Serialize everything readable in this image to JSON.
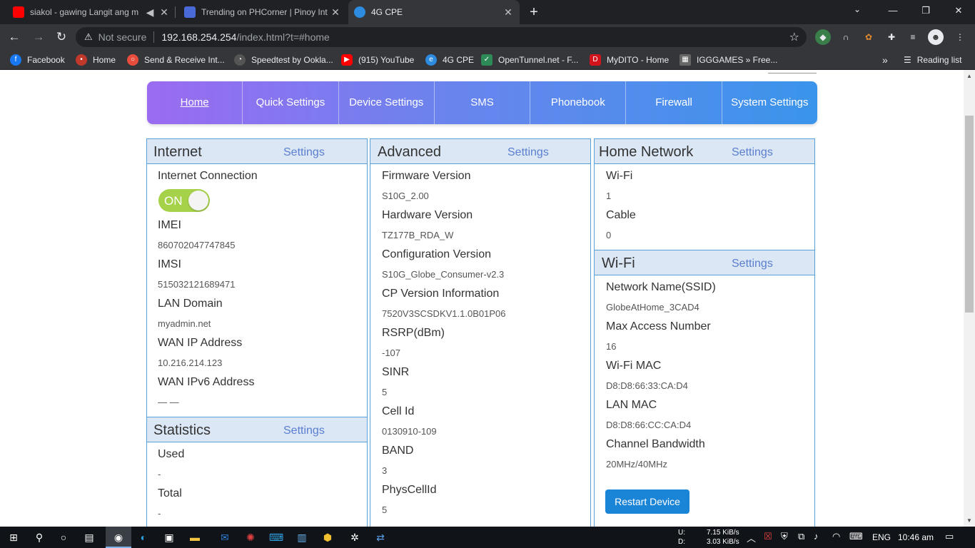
{
  "browser": {
    "tabs": [
      {
        "title": "siakol - gawing Langit ang m",
        "icon": "youtube-icon",
        "color": "#ff0000"
      },
      {
        "title": "Trending on PHCorner | Pinoy Int",
        "icon": "phcorner-icon",
        "color": "#4a6ad8"
      },
      {
        "title": "4G CPE",
        "icon": "cpe-icon",
        "color": "#2d8be0"
      }
    ],
    "new_tab": "+",
    "omnibox": {
      "security": "Not secure",
      "host": "192.168.254.254",
      "path": "/index.html?t=#home"
    },
    "bookmarks": [
      {
        "label": "Facebook",
        "color": "#1877f2",
        "glyph": "f"
      },
      {
        "label": "Home",
        "color": "#c0392b",
        "glyph": "•"
      },
      {
        "label": "Send & Receive Int...",
        "color": "#e74c3c",
        "glyph": "○"
      },
      {
        "label": "Speedtest by Ookla...",
        "color": "#555",
        "glyph": "◔"
      },
      {
        "label": "(915) YouTube",
        "color": "#ff0000",
        "glyph": "▶"
      },
      {
        "label": "4G CPE",
        "color": "#2d8be0",
        "glyph": "e"
      },
      {
        "label": "OpenTunnel.net - F...",
        "color": "#2e8b57",
        "glyph": "✓"
      },
      {
        "label": "MyDITO - Home",
        "color": "#d4141c",
        "glyph": "D"
      },
      {
        "label": "IGGGAMES » Free...",
        "color": "#666",
        "glyph": "▦"
      }
    ],
    "overflow": "»",
    "reading_list": "Reading list"
  },
  "nav": {
    "items": [
      "Home",
      "Quick Settings",
      "Device Settings",
      "SMS",
      "Phonebook",
      "Firewall",
      "System Settings"
    ],
    "active": "Home"
  },
  "internet": {
    "title": "Internet",
    "settings": "Settings",
    "connection_label": "Internet Connection",
    "toggle": "ON",
    "rows": [
      {
        "label": "IMEI",
        "value": "860702047747845"
      },
      {
        "label": "IMSI",
        "value": "515032121689471"
      },
      {
        "label": "LAN Domain",
        "value": "myadmin.net"
      },
      {
        "label": "WAN IP Address",
        "value": "10.216.214.123"
      },
      {
        "label": "WAN IPv6 Address",
        "value": "— —"
      }
    ]
  },
  "statistics": {
    "title": "Statistics",
    "settings": "Settings",
    "rows": [
      {
        "label": "Used",
        "value": "-"
      },
      {
        "label": "Total",
        "value": "-"
      }
    ]
  },
  "advanced": {
    "title": "Advanced",
    "settings": "Settings",
    "rows": [
      {
        "label": "Firmware Version",
        "value": "S10G_2.00"
      },
      {
        "label": "Hardware Version",
        "value": "TZ177B_RDA_W"
      },
      {
        "label": "Configuration Version",
        "value": "S10G_Globe_Consumer-v2.3"
      },
      {
        "label": "CP Version Information",
        "value": "7520V3SCSDKV1.1.0B01P06"
      },
      {
        "label": "RSRP(dBm)",
        "value": "-107"
      },
      {
        "label": "SINR",
        "value": "5"
      },
      {
        "label": "Cell Id",
        "value": "0130910-109"
      },
      {
        "label": "BAND",
        "value": "3"
      },
      {
        "label": "PhysCellId",
        "value": "5"
      }
    ]
  },
  "home_network": {
    "title": "Home Network",
    "settings": "Settings",
    "rows": [
      {
        "label": "Wi-Fi",
        "value": "1"
      },
      {
        "label": "Cable",
        "value": "0"
      }
    ]
  },
  "wifi": {
    "title": "Wi-Fi",
    "settings": "Settings",
    "rows": [
      {
        "label": "Network Name(SSID)",
        "value": "GlobeAtHome_3CAD4"
      },
      {
        "label": "Max Access Number",
        "value": "16"
      },
      {
        "label": "Wi-Fi MAC",
        "value": "D8:D8:66:33:CA:D4"
      },
      {
        "label": "LAN MAC",
        "value": "D8:D8:66:CC:CA:D4"
      },
      {
        "label": "Channel Bandwidth",
        "value": "20MHz/40MHz"
      }
    ],
    "restart": "Restart Device"
  },
  "taskbar": {
    "net_up_label": "U:",
    "net_up": "7.15 KiB/s",
    "net_down_label": "D:",
    "net_down": "3.03 KiB/s",
    "lang": "ENG",
    "time": "10:46 am"
  },
  "colors": {
    "panel_border": "#5aa0d8",
    "panel_head": "#dbe7f5",
    "settings_link": "#5b7fd0",
    "toggle_on": "#a6d24a",
    "restart_button": "#1a84d6"
  }
}
